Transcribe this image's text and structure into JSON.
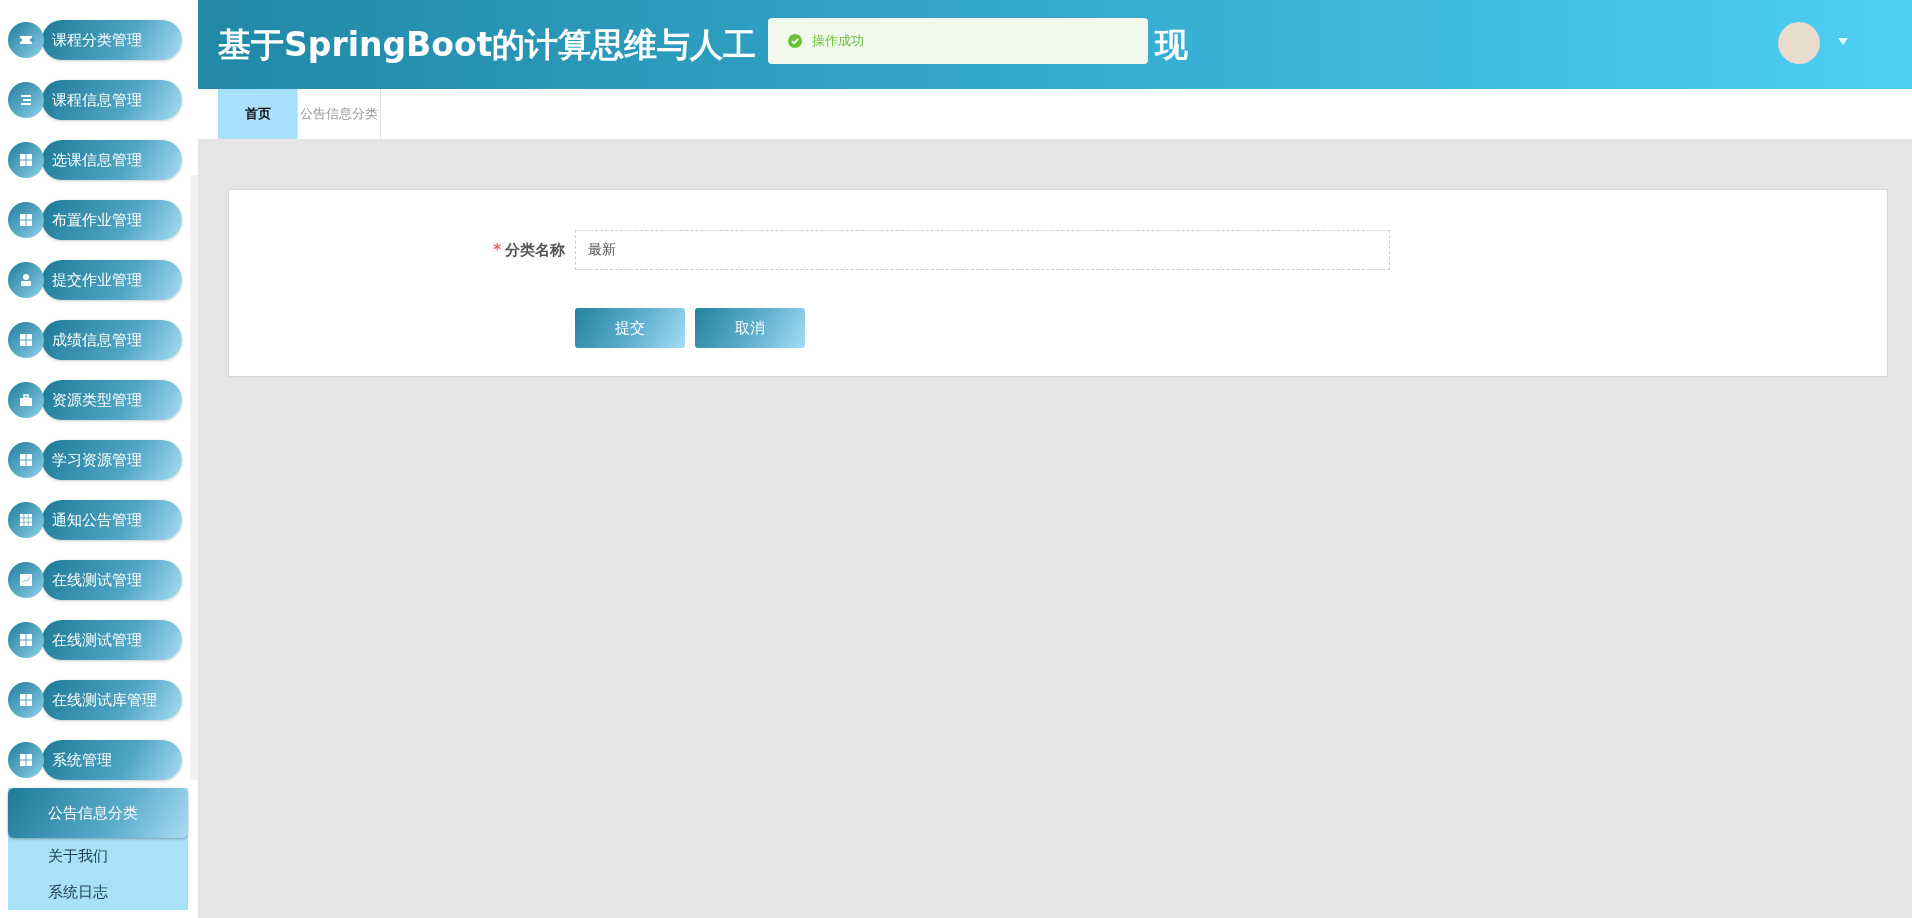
{
  "sidebar": {
    "items": [
      {
        "label": "课程分类管理"
      },
      {
        "label": "课程信息管理"
      },
      {
        "label": "选课信息管理"
      },
      {
        "label": "布置作业管理"
      },
      {
        "label": "提交作业管理"
      },
      {
        "label": "成绩信息管理"
      },
      {
        "label": "资源类型管理"
      },
      {
        "label": "学习资源管理"
      },
      {
        "label": "通知公告管理"
      },
      {
        "label": "在线测试管理"
      },
      {
        "label": "在线测试管理"
      },
      {
        "label": "在线测试库管理"
      },
      {
        "label": "系统管理",
        "children": [
          {
            "label": "公告信息分类",
            "selected": true
          },
          {
            "label": "关于我们",
            "selected": false
          },
          {
            "label": "系统日志",
            "selected": false
          }
        ]
      }
    ]
  },
  "header": {
    "title_start": "基于SpringBoot的计算思维与人工",
    "title_end": "现"
  },
  "toast": {
    "kind": "success",
    "message": "操作成功"
  },
  "tabs": [
    {
      "label": "首页",
      "selected": true
    },
    {
      "label": "公告信息分类",
      "selected": false
    }
  ],
  "form": {
    "fields": [
      {
        "label": "分类名称",
        "required_mark": "*",
        "value": "最新"
      }
    ],
    "buttons": [
      "提交",
      "取消"
    ]
  }
}
